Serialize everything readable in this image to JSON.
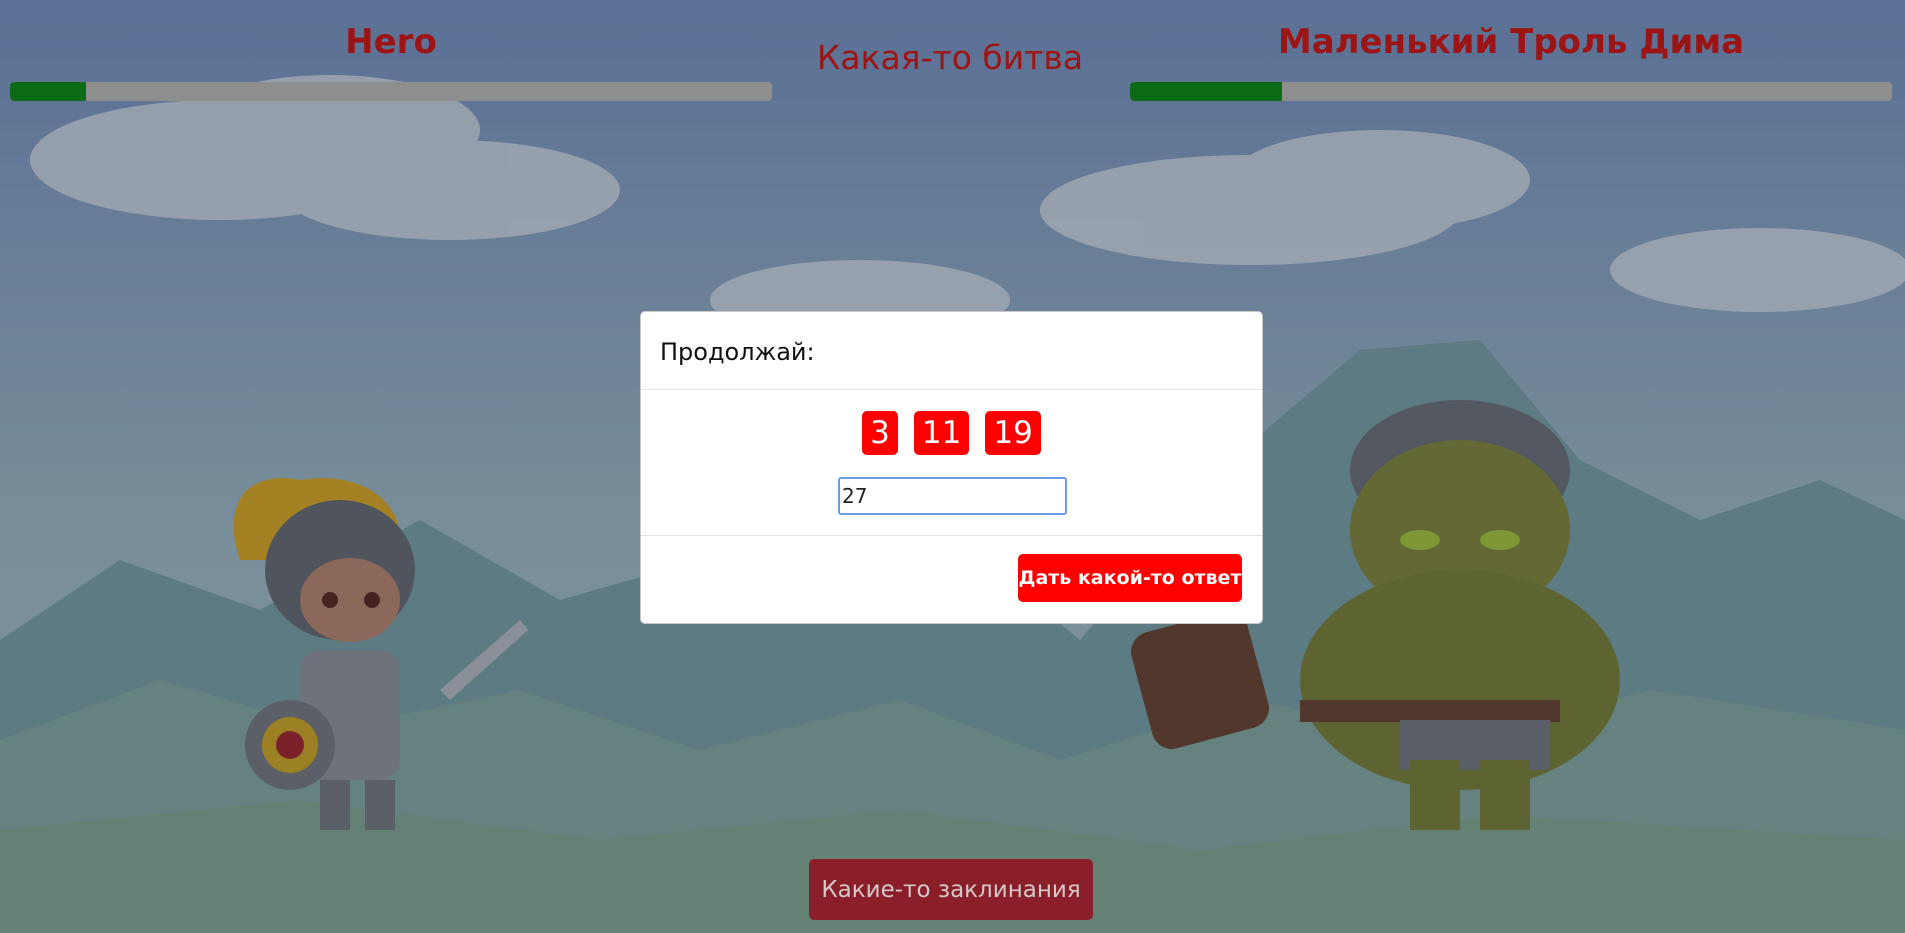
{
  "hero": {
    "name": "Hero",
    "hp_fraction": 0.1
  },
  "enemy": {
    "name": "Маленький Троль Дима",
    "hp_fraction": 0.2
  },
  "battle_title": "Какая-то битва",
  "modal": {
    "title": "Продолжай:",
    "numbers": [
      "3",
      "11",
      "19"
    ],
    "answer_value": "27",
    "submit_label": "Дать какой-то ответ"
  },
  "spells_label": "Какие-то заклинания",
  "colors": {
    "title_red": "#9c1414",
    "accent_red": "#ff0000",
    "hp_green": "#0b6b17",
    "hp_track": "#8e8e8e",
    "spells_button": "#8a1e29"
  }
}
